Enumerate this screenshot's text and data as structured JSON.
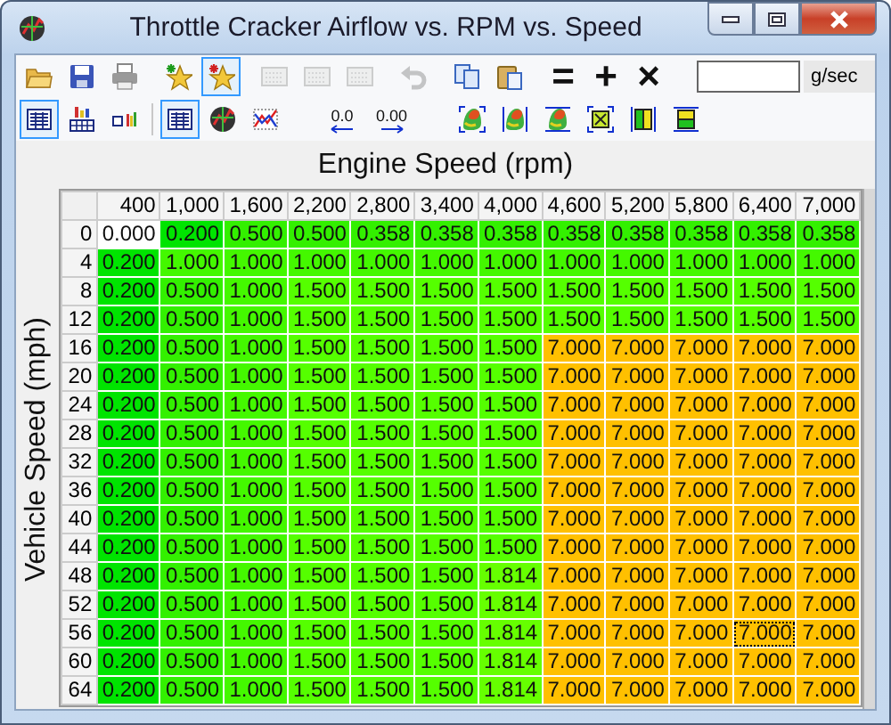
{
  "window": {
    "title": "Throttle Cracker Airflow vs. RPM vs. Speed"
  },
  "toolbar_1": [
    {
      "kind": "icon",
      "pressed": false,
      "disabled": false
    },
    {
      "kind": "icon",
      "pressed": false,
      "disabled": false
    },
    {
      "kind": "icon",
      "pressed": false,
      "disabled": false
    },
    {
      "kind": "separator"
    },
    {
      "kind": "icon",
      "pressed": false,
      "disabled": false
    },
    {
      "kind": "icon",
      "pressed": true,
      "disabled": false
    },
    {
      "kind": "separator"
    },
    {
      "kind": "icon",
      "pressed": false,
      "disabled": true
    },
    {
      "kind": "icon",
      "pressed": false,
      "disabled": true
    },
    {
      "kind": "icon",
      "pressed": false,
      "disabled": true
    },
    {
      "kind": "separator"
    },
    {
      "kind": "icon",
      "pressed": false,
      "disabled": true
    },
    {
      "kind": "separator"
    },
    {
      "kind": "icon",
      "pressed": false,
      "disabled": false
    },
    {
      "kind": "icon",
      "pressed": false,
      "disabled": false
    },
    {
      "kind": "separator"
    },
    {
      "kind": "text",
      "label": "=",
      "pressed": false,
      "disabled": false
    },
    {
      "kind": "text",
      "label": "+",
      "pressed": false,
      "disabled": false
    },
    {
      "kind": "text",
      "label": "×",
      "pressed": false,
      "disabled": false
    },
    {
      "kind": "field"
    },
    {
      "kind": "unit",
      "label": "g/sec"
    }
  ],
  "toolbar_2": [
    {
      "kind": "icon",
      "pressed": true,
      "disabled": false
    },
    {
      "kind": "icon",
      "pressed": false,
      "disabled": false
    },
    {
      "kind": "icon",
      "pressed": false,
      "disabled": false
    },
    {
      "kind": "separator"
    },
    {
      "kind": "icon",
      "pressed": true,
      "disabled": false
    },
    {
      "kind": "icon",
      "pressed": false,
      "disabled": false
    },
    {
      "kind": "icon",
      "pressed": false,
      "disabled": false
    },
    {
      "kind": "gap"
    },
    {
      "kind": "decimal-left",
      "label": "0.0",
      "pressed": false,
      "disabled": false
    },
    {
      "kind": "decimal-right",
      "label": "0.00",
      "pressed": false,
      "disabled": false
    },
    {
      "kind": "gap"
    },
    {
      "kind": "icon",
      "pressed": false,
      "disabled": false
    },
    {
      "kind": "icon",
      "pressed": false,
      "disabled": false
    },
    {
      "kind": "icon",
      "pressed": false,
      "disabled": false
    },
    {
      "kind": "icon",
      "pressed": false,
      "disabled": false
    },
    {
      "kind": "icon",
      "pressed": false,
      "disabled": false
    },
    {
      "kind": "icon",
      "pressed": false,
      "disabled": false
    }
  ],
  "table": {
    "x_axis_title": "Engine Speed (rpm)",
    "y_axis_title": "Vehicle Speed (mph)",
    "columns": [
      "400",
      "1,000",
      "1,600",
      "2,200",
      "2,800",
      "3,400",
      "4,000",
      "4,600",
      "5,200",
      "5,800",
      "6,400",
      "7,000"
    ],
    "rows": [
      {
        "label": "0",
        "cells": [
          {
            "value": "0.000",
            "color": "#ffffff",
            "selected": false
          },
          {
            "value": "0.200",
            "color": "#00e400",
            "selected": false
          },
          {
            "value": "0.500",
            "color": "#33f000",
            "selected": false
          },
          {
            "value": "0.500",
            "color": "#33f000",
            "selected": false
          },
          {
            "value": "0.358",
            "color": "#33f000",
            "selected": false
          },
          {
            "value": "0.358",
            "color": "#33f000",
            "selected": false
          },
          {
            "value": "0.358",
            "color": "#33f000",
            "selected": false
          },
          {
            "value": "0.358",
            "color": "#33f000",
            "selected": false
          },
          {
            "value": "0.358",
            "color": "#33f000",
            "selected": false
          },
          {
            "value": "0.358",
            "color": "#33f000",
            "selected": false
          },
          {
            "value": "0.358",
            "color": "#33f000",
            "selected": false
          },
          {
            "value": "0.358",
            "color": "#33f000",
            "selected": false
          }
        ]
      },
      {
        "label": "4",
        "cells": [
          {
            "value": "0.200",
            "color": "#00e400",
            "selected": false
          },
          {
            "value": "1.000",
            "color": "#44f800",
            "selected": false
          },
          {
            "value": "1.000",
            "color": "#44f800",
            "selected": false
          },
          {
            "value": "1.000",
            "color": "#44f800",
            "selected": false
          },
          {
            "value": "1.000",
            "color": "#44f800",
            "selected": false
          },
          {
            "value": "1.000",
            "color": "#44f800",
            "selected": false
          },
          {
            "value": "1.000",
            "color": "#44f800",
            "selected": false
          },
          {
            "value": "1.000",
            "color": "#44f800",
            "selected": false
          },
          {
            "value": "1.000",
            "color": "#44f800",
            "selected": false
          },
          {
            "value": "1.000",
            "color": "#44f800",
            "selected": false
          },
          {
            "value": "1.000",
            "color": "#44f800",
            "selected": false
          },
          {
            "value": "1.000",
            "color": "#44f800",
            "selected": false
          }
        ]
      },
      {
        "label": "8",
        "cells": [
          {
            "value": "0.200",
            "color": "#00e400",
            "selected": false
          },
          {
            "value": "0.500",
            "color": "#33f000",
            "selected": false
          },
          {
            "value": "1.000",
            "color": "#44f800",
            "selected": false
          },
          {
            "value": "1.500",
            "color": "#55ff00",
            "selected": false
          },
          {
            "value": "1.500",
            "color": "#55ff00",
            "selected": false
          },
          {
            "value": "1.500",
            "color": "#55ff00",
            "selected": false
          },
          {
            "value": "1.500",
            "color": "#55ff00",
            "selected": false
          },
          {
            "value": "1.500",
            "color": "#55ff00",
            "selected": false
          },
          {
            "value": "1.500",
            "color": "#55ff00",
            "selected": false
          },
          {
            "value": "1.500",
            "color": "#55ff00",
            "selected": false
          },
          {
            "value": "1.500",
            "color": "#55ff00",
            "selected": false
          },
          {
            "value": "1.500",
            "color": "#55ff00",
            "selected": false
          }
        ]
      },
      {
        "label": "12",
        "cells": [
          {
            "value": "0.200",
            "color": "#00e400",
            "selected": false
          },
          {
            "value": "0.500",
            "color": "#33f000",
            "selected": false
          },
          {
            "value": "1.000",
            "color": "#44f800",
            "selected": false
          },
          {
            "value": "1.500",
            "color": "#55ff00",
            "selected": false
          },
          {
            "value": "1.500",
            "color": "#55ff00",
            "selected": false
          },
          {
            "value": "1.500",
            "color": "#55ff00",
            "selected": false
          },
          {
            "value": "1.500",
            "color": "#55ff00",
            "selected": false
          },
          {
            "value": "1.500",
            "color": "#55ff00",
            "selected": false
          },
          {
            "value": "1.500",
            "color": "#55ff00",
            "selected": false
          },
          {
            "value": "1.500",
            "color": "#55ff00",
            "selected": false
          },
          {
            "value": "1.500",
            "color": "#55ff00",
            "selected": false
          },
          {
            "value": "1.500",
            "color": "#55ff00",
            "selected": false
          }
        ]
      },
      {
        "label": "16",
        "cells": [
          {
            "value": "0.200",
            "color": "#00e400",
            "selected": false
          },
          {
            "value": "0.500",
            "color": "#33f000",
            "selected": false
          },
          {
            "value": "1.000",
            "color": "#44f800",
            "selected": false
          },
          {
            "value": "1.500",
            "color": "#55ff00",
            "selected": false
          },
          {
            "value": "1.500",
            "color": "#55ff00",
            "selected": false
          },
          {
            "value": "1.500",
            "color": "#55ff00",
            "selected": false
          },
          {
            "value": "1.500",
            "color": "#55ff00",
            "selected": false
          },
          {
            "value": "7.000",
            "color": "#ffc000",
            "selected": false
          },
          {
            "value": "7.000",
            "color": "#ffc000",
            "selected": false
          },
          {
            "value": "7.000",
            "color": "#ffc000",
            "selected": false
          },
          {
            "value": "7.000",
            "color": "#ffc000",
            "selected": false
          },
          {
            "value": "7.000",
            "color": "#ffc000",
            "selected": false
          }
        ]
      },
      {
        "label": "20",
        "cells": [
          {
            "value": "0.200",
            "color": "#00e400",
            "selected": false
          },
          {
            "value": "0.500",
            "color": "#33f000",
            "selected": false
          },
          {
            "value": "1.000",
            "color": "#44f800",
            "selected": false
          },
          {
            "value": "1.500",
            "color": "#55ff00",
            "selected": false
          },
          {
            "value": "1.500",
            "color": "#55ff00",
            "selected": false
          },
          {
            "value": "1.500",
            "color": "#55ff00",
            "selected": false
          },
          {
            "value": "1.500",
            "color": "#55ff00",
            "selected": false
          },
          {
            "value": "7.000",
            "color": "#ffc000",
            "selected": false
          },
          {
            "value": "7.000",
            "color": "#ffc000",
            "selected": false
          },
          {
            "value": "7.000",
            "color": "#ffc000",
            "selected": false
          },
          {
            "value": "7.000",
            "color": "#ffc000",
            "selected": false
          },
          {
            "value": "7.000",
            "color": "#ffc000",
            "selected": false
          }
        ]
      },
      {
        "label": "24",
        "cells": [
          {
            "value": "0.200",
            "color": "#00e400",
            "selected": false
          },
          {
            "value": "0.500",
            "color": "#33f000",
            "selected": false
          },
          {
            "value": "1.000",
            "color": "#44f800",
            "selected": false
          },
          {
            "value": "1.500",
            "color": "#55ff00",
            "selected": false
          },
          {
            "value": "1.500",
            "color": "#55ff00",
            "selected": false
          },
          {
            "value": "1.500",
            "color": "#55ff00",
            "selected": false
          },
          {
            "value": "1.500",
            "color": "#55ff00",
            "selected": false
          },
          {
            "value": "7.000",
            "color": "#ffc000",
            "selected": false
          },
          {
            "value": "7.000",
            "color": "#ffc000",
            "selected": false
          },
          {
            "value": "7.000",
            "color": "#ffc000",
            "selected": false
          },
          {
            "value": "7.000",
            "color": "#ffc000",
            "selected": false
          },
          {
            "value": "7.000",
            "color": "#ffc000",
            "selected": false
          }
        ]
      },
      {
        "label": "28",
        "cells": [
          {
            "value": "0.200",
            "color": "#00e400",
            "selected": false
          },
          {
            "value": "0.500",
            "color": "#33f000",
            "selected": false
          },
          {
            "value": "1.000",
            "color": "#44f800",
            "selected": false
          },
          {
            "value": "1.500",
            "color": "#55ff00",
            "selected": false
          },
          {
            "value": "1.500",
            "color": "#55ff00",
            "selected": false
          },
          {
            "value": "1.500",
            "color": "#55ff00",
            "selected": false
          },
          {
            "value": "1.500",
            "color": "#55ff00",
            "selected": false
          },
          {
            "value": "7.000",
            "color": "#ffc000",
            "selected": false
          },
          {
            "value": "7.000",
            "color": "#ffc000",
            "selected": false
          },
          {
            "value": "7.000",
            "color": "#ffc000",
            "selected": false
          },
          {
            "value": "7.000",
            "color": "#ffc000",
            "selected": false
          },
          {
            "value": "7.000",
            "color": "#ffc000",
            "selected": false
          }
        ]
      },
      {
        "label": "32",
        "cells": [
          {
            "value": "0.200",
            "color": "#00e400",
            "selected": false
          },
          {
            "value": "0.500",
            "color": "#33f000",
            "selected": false
          },
          {
            "value": "1.000",
            "color": "#44f800",
            "selected": false
          },
          {
            "value": "1.500",
            "color": "#55ff00",
            "selected": false
          },
          {
            "value": "1.500",
            "color": "#55ff00",
            "selected": false
          },
          {
            "value": "1.500",
            "color": "#55ff00",
            "selected": false
          },
          {
            "value": "1.500",
            "color": "#55ff00",
            "selected": false
          },
          {
            "value": "7.000",
            "color": "#ffc000",
            "selected": false
          },
          {
            "value": "7.000",
            "color": "#ffc000",
            "selected": false
          },
          {
            "value": "7.000",
            "color": "#ffc000",
            "selected": false
          },
          {
            "value": "7.000",
            "color": "#ffc000",
            "selected": false
          },
          {
            "value": "7.000",
            "color": "#ffc000",
            "selected": false
          }
        ]
      },
      {
        "label": "36",
        "cells": [
          {
            "value": "0.200",
            "color": "#00e400",
            "selected": false
          },
          {
            "value": "0.500",
            "color": "#33f000",
            "selected": false
          },
          {
            "value": "1.000",
            "color": "#44f800",
            "selected": false
          },
          {
            "value": "1.500",
            "color": "#55ff00",
            "selected": false
          },
          {
            "value": "1.500",
            "color": "#55ff00",
            "selected": false
          },
          {
            "value": "1.500",
            "color": "#55ff00",
            "selected": false
          },
          {
            "value": "1.500",
            "color": "#55ff00",
            "selected": false
          },
          {
            "value": "7.000",
            "color": "#ffc000",
            "selected": false
          },
          {
            "value": "7.000",
            "color": "#ffc000",
            "selected": false
          },
          {
            "value": "7.000",
            "color": "#ffc000",
            "selected": false
          },
          {
            "value": "7.000",
            "color": "#ffc000",
            "selected": false
          },
          {
            "value": "7.000",
            "color": "#ffc000",
            "selected": false
          }
        ]
      },
      {
        "label": "40",
        "cells": [
          {
            "value": "0.200",
            "color": "#00e400",
            "selected": false
          },
          {
            "value": "0.500",
            "color": "#33f000",
            "selected": false
          },
          {
            "value": "1.000",
            "color": "#44f800",
            "selected": false
          },
          {
            "value": "1.500",
            "color": "#55ff00",
            "selected": false
          },
          {
            "value": "1.500",
            "color": "#55ff00",
            "selected": false
          },
          {
            "value": "1.500",
            "color": "#55ff00",
            "selected": false
          },
          {
            "value": "1.500",
            "color": "#55ff00",
            "selected": false
          },
          {
            "value": "7.000",
            "color": "#ffc000",
            "selected": false
          },
          {
            "value": "7.000",
            "color": "#ffc000",
            "selected": false
          },
          {
            "value": "7.000",
            "color": "#ffc000",
            "selected": false
          },
          {
            "value": "7.000",
            "color": "#ffc000",
            "selected": false
          },
          {
            "value": "7.000",
            "color": "#ffc000",
            "selected": false
          }
        ]
      },
      {
        "label": "44",
        "cells": [
          {
            "value": "0.200",
            "color": "#00e400",
            "selected": false
          },
          {
            "value": "0.500",
            "color": "#33f000",
            "selected": false
          },
          {
            "value": "1.000",
            "color": "#44f800",
            "selected": false
          },
          {
            "value": "1.500",
            "color": "#55ff00",
            "selected": false
          },
          {
            "value": "1.500",
            "color": "#55ff00",
            "selected": false
          },
          {
            "value": "1.500",
            "color": "#55ff00",
            "selected": false
          },
          {
            "value": "1.500",
            "color": "#55ff00",
            "selected": false
          },
          {
            "value": "7.000",
            "color": "#ffc000",
            "selected": false
          },
          {
            "value": "7.000",
            "color": "#ffc000",
            "selected": false
          },
          {
            "value": "7.000",
            "color": "#ffc000",
            "selected": false
          },
          {
            "value": "7.000",
            "color": "#ffc000",
            "selected": false
          },
          {
            "value": "7.000",
            "color": "#ffc000",
            "selected": false
          }
        ]
      },
      {
        "label": "48",
        "cells": [
          {
            "value": "0.200",
            "color": "#00e400",
            "selected": false
          },
          {
            "value": "0.500",
            "color": "#33f000",
            "selected": false
          },
          {
            "value": "1.000",
            "color": "#44f800",
            "selected": false
          },
          {
            "value": "1.500",
            "color": "#55ff00",
            "selected": false
          },
          {
            "value": "1.500",
            "color": "#55ff00",
            "selected": false
          },
          {
            "value": "1.500",
            "color": "#55ff00",
            "selected": false
          },
          {
            "value": "1.814",
            "color": "#66ff00",
            "selected": false
          },
          {
            "value": "7.000",
            "color": "#ffc000",
            "selected": false
          },
          {
            "value": "7.000",
            "color": "#ffc000",
            "selected": false
          },
          {
            "value": "7.000",
            "color": "#ffc000",
            "selected": false
          },
          {
            "value": "7.000",
            "color": "#ffc000",
            "selected": false
          },
          {
            "value": "7.000",
            "color": "#ffc000",
            "selected": false
          }
        ]
      },
      {
        "label": "52",
        "cells": [
          {
            "value": "0.200",
            "color": "#00e400",
            "selected": false
          },
          {
            "value": "0.500",
            "color": "#33f000",
            "selected": false
          },
          {
            "value": "1.000",
            "color": "#44f800",
            "selected": false
          },
          {
            "value": "1.500",
            "color": "#55ff00",
            "selected": false
          },
          {
            "value": "1.500",
            "color": "#55ff00",
            "selected": false
          },
          {
            "value": "1.500",
            "color": "#55ff00",
            "selected": false
          },
          {
            "value": "1.814",
            "color": "#66ff00",
            "selected": false
          },
          {
            "value": "7.000",
            "color": "#ffc000",
            "selected": false
          },
          {
            "value": "7.000",
            "color": "#ffc000",
            "selected": false
          },
          {
            "value": "7.000",
            "color": "#ffc000",
            "selected": false
          },
          {
            "value": "7.000",
            "color": "#ffc000",
            "selected": false
          },
          {
            "value": "7.000",
            "color": "#ffc000",
            "selected": false
          }
        ]
      },
      {
        "label": "56",
        "cells": [
          {
            "value": "0.200",
            "color": "#00e400",
            "selected": false
          },
          {
            "value": "0.500",
            "color": "#33f000",
            "selected": false
          },
          {
            "value": "1.000",
            "color": "#44f800",
            "selected": false
          },
          {
            "value": "1.500",
            "color": "#55ff00",
            "selected": false
          },
          {
            "value": "1.500",
            "color": "#55ff00",
            "selected": false
          },
          {
            "value": "1.500",
            "color": "#55ff00",
            "selected": false
          },
          {
            "value": "1.814",
            "color": "#66ff00",
            "selected": false
          },
          {
            "value": "7.000",
            "color": "#ffc000",
            "selected": false
          },
          {
            "value": "7.000",
            "color": "#ffc000",
            "selected": false
          },
          {
            "value": "7.000",
            "color": "#ffc000",
            "selected": false
          },
          {
            "value": "7.000",
            "color": "#ffc000",
            "selected": true
          },
          {
            "value": "7.000",
            "color": "#ffc000",
            "selected": false
          }
        ]
      },
      {
        "label": "60",
        "cells": [
          {
            "value": "0.200",
            "color": "#00e400",
            "selected": false
          },
          {
            "value": "0.500",
            "color": "#33f000",
            "selected": false
          },
          {
            "value": "1.000",
            "color": "#44f800",
            "selected": false
          },
          {
            "value": "1.500",
            "color": "#55ff00",
            "selected": false
          },
          {
            "value": "1.500",
            "color": "#55ff00",
            "selected": false
          },
          {
            "value": "1.500",
            "color": "#55ff00",
            "selected": false
          },
          {
            "value": "1.814",
            "color": "#66ff00",
            "selected": false
          },
          {
            "value": "7.000",
            "color": "#ffc000",
            "selected": false
          },
          {
            "value": "7.000",
            "color": "#ffc000",
            "selected": false
          },
          {
            "value": "7.000",
            "color": "#ffc000",
            "selected": false
          },
          {
            "value": "7.000",
            "color": "#ffc000",
            "selected": false
          },
          {
            "value": "7.000",
            "color": "#ffc000",
            "selected": false
          }
        ]
      },
      {
        "label": "64",
        "cells": [
          {
            "value": "0.200",
            "color": "#00e400",
            "selected": false
          },
          {
            "value": "0.500",
            "color": "#33f000",
            "selected": false
          },
          {
            "value": "1.000",
            "color": "#44f800",
            "selected": false
          },
          {
            "value": "1.500",
            "color": "#55ff00",
            "selected": false
          },
          {
            "value": "1.500",
            "color": "#55ff00",
            "selected": false
          },
          {
            "value": "1.500",
            "color": "#55ff00",
            "selected": false
          },
          {
            "value": "1.814",
            "color": "#66ff00",
            "selected": false
          },
          {
            "value": "7.000",
            "color": "#ffc000",
            "selected": false
          },
          {
            "value": "7.000",
            "color": "#ffc000",
            "selected": false
          },
          {
            "value": "7.000",
            "color": "#ffc000",
            "selected": false
          },
          {
            "value": "7.000",
            "color": "#ffc000",
            "selected": false
          },
          {
            "value": "7.000",
            "color": "#ffc000",
            "selected": false
          }
        ]
      }
    ]
  }
}
